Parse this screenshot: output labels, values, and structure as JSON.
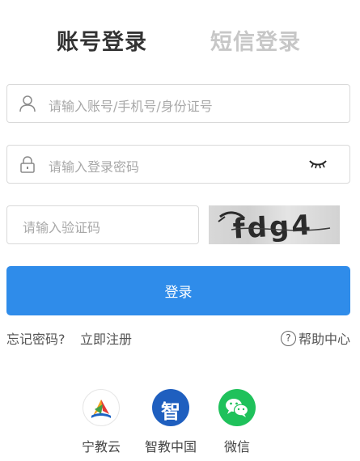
{
  "tabs": {
    "account_login": "账号登录",
    "sms_login": "短信登录"
  },
  "form": {
    "account_placeholder": "请输入账号/手机号/身份证号",
    "password_placeholder": "请输入登录密码",
    "captcha_placeholder": "请输入验证码",
    "captcha_text": "fdg4",
    "login_button": "登录"
  },
  "links": {
    "forgot_password": "忘记密码?",
    "register": "立即注册",
    "help_center": "帮助中心"
  },
  "social": {
    "ningjiao": "宁教云",
    "zhijiao": "智教中国",
    "zhijiao_glyph": "智",
    "wechat": "微信"
  },
  "colors": {
    "primary": "#2f8cea",
    "tab_highlight": "#8fc3f3",
    "wechat_green": "#1fc15b",
    "zhijiao_blue": "#1f5fbf"
  }
}
